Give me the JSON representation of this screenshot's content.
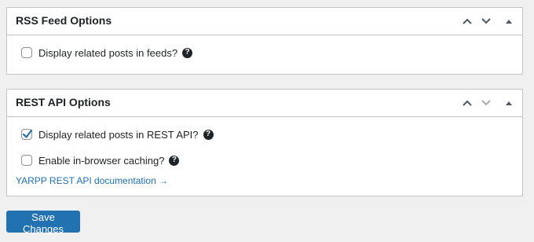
{
  "rss_box": {
    "title": "RSS Feed Options",
    "options": [
      {
        "label": "Display related posts in feeds?",
        "checked": false,
        "help": "?"
      }
    ]
  },
  "rest_box": {
    "title": "REST API Options",
    "options": [
      {
        "label": "Display related posts in REST API?",
        "checked": true,
        "help": "?"
      },
      {
        "label": "Enable in-browser caching?",
        "checked": false,
        "help": "?"
      }
    ],
    "doc_link": "YARPP REST API documentation →"
  },
  "save_label": "Save Changes",
  "icons": {
    "move_up": "chevron-up-icon",
    "move_down": "chevron-down-icon",
    "toggle": "triangle-up-icon",
    "help": "help-circle-icon",
    "check": "checkmark-icon"
  },
  "colors": {
    "accent": "#2271b1",
    "border": "#c3c4c7",
    "background": "#f0f0f1"
  }
}
